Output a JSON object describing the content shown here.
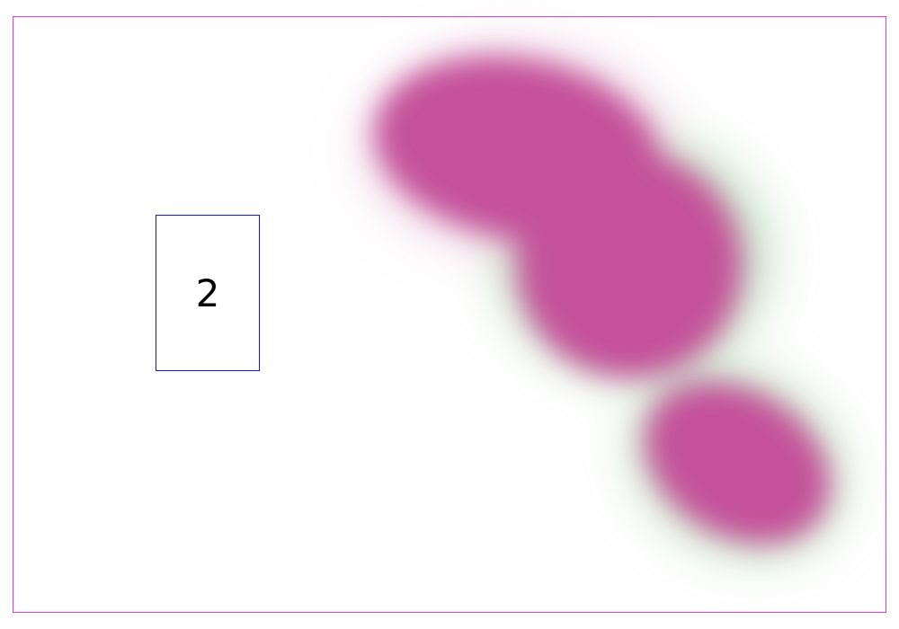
{
  "label": {
    "number": "2"
  },
  "colors": {
    "background": "#ffffff",
    "frame_border": "#e23ce6",
    "label_border": "#1515d8",
    "blob_fill": "#c4519a",
    "blob_halo": "#8cc48c"
  }
}
